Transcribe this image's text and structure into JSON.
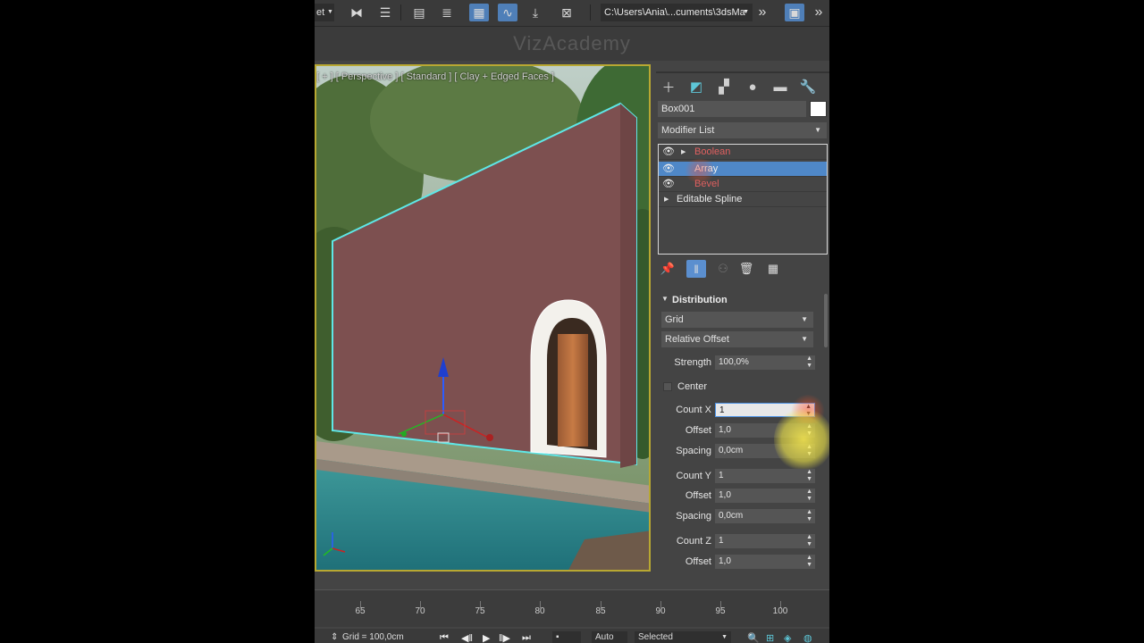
{
  "toolbar": {
    "selection_filter": "et",
    "project_path": "C:\\Users\\Ania\\...cuments\\3dsMa"
  },
  "watermark": "VizAcademy",
  "viewport": {
    "label": "[ + ] [ Perspective ] [ Standard ] [ Clay + Edged Faces ]"
  },
  "command_panel": {
    "object_name": "Box001",
    "object_color": "#ffffff",
    "modifier_list": "Modifier List",
    "stack": [
      {
        "label": "Boolean",
        "selected": false
      },
      {
        "label": "Array",
        "selected": true
      },
      {
        "label": "Bevel",
        "selected": false
      },
      {
        "label": "Editable Spline",
        "selected": false
      }
    ],
    "rollout": {
      "title": "Distribution",
      "distribution_type": "Grid",
      "offset_mode": "Relative Offset",
      "strength_label": "Strength",
      "strength_value": "100,0%",
      "center_label": "Center",
      "count_x_label": "Count X",
      "count_x_value": "1",
      "offset_x_label": "Offset",
      "offset_x_value": "1,0",
      "spacing_x_label": "Spacing",
      "spacing_x_value": "0,0cm",
      "count_y_label": "Count Y",
      "count_y_value": "1",
      "offset_y_label": "Offset",
      "offset_y_value": "1,0",
      "spacing_y_label": "Spacing",
      "spacing_y_value": "0,0cm",
      "count_z_label": "Count Z",
      "count_z_value": "1",
      "offset_z_label": "Offset",
      "offset_z_value": "1,0"
    }
  },
  "timeline": {
    "ticks": [
      "65",
      "70",
      "75",
      "80",
      "85",
      "90",
      "95",
      "100"
    ]
  },
  "statusbar": {
    "grid": "Grid = 100,0cm",
    "auto": "Auto",
    "selected": "Selected"
  },
  "colors": {
    "accent": "#4f88c8",
    "modifier_text": "#e06060",
    "wall": "#7d5050",
    "selection_outline": "#5ee7e7",
    "viewport_border": "#b8a832"
  }
}
